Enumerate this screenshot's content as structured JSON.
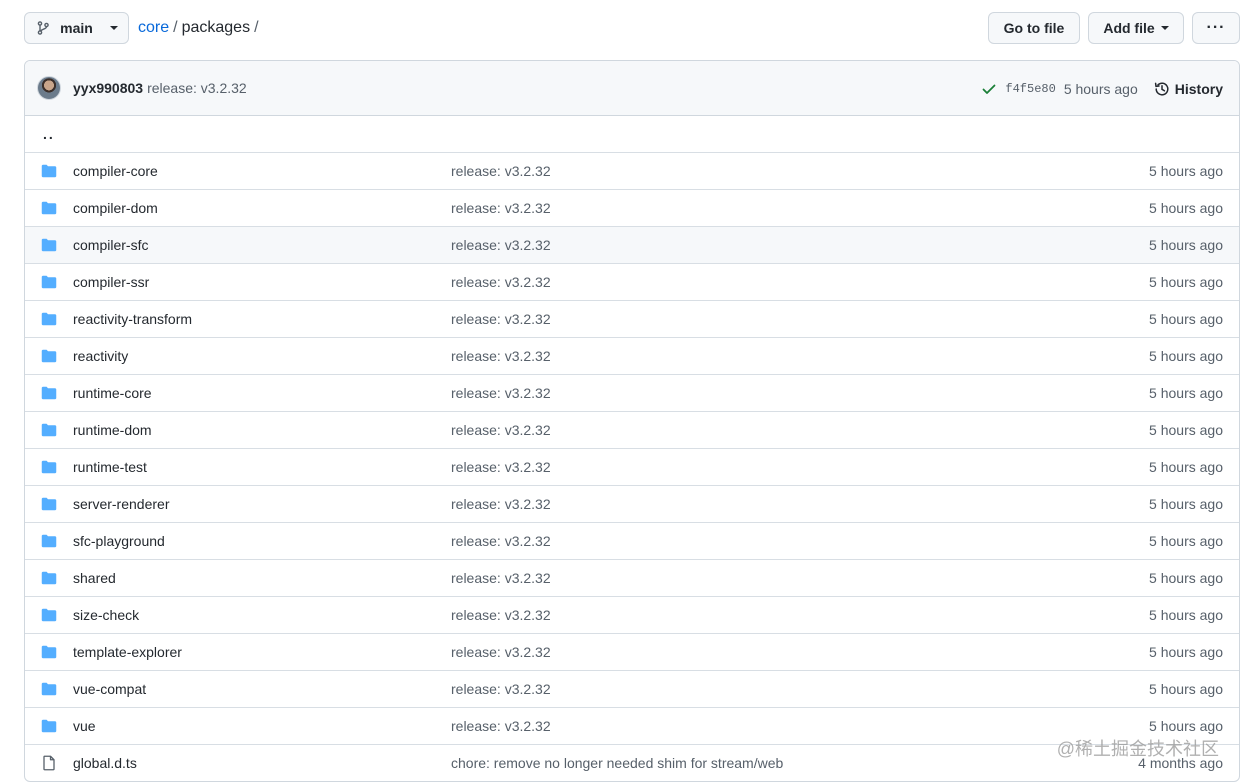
{
  "branch": {
    "label": "main"
  },
  "breadcrumb": {
    "repo": "core",
    "sep1": "/",
    "dir": "packages",
    "sep2": "/"
  },
  "actions": {
    "goto_file": "Go to file",
    "add_file": "Add file",
    "more": "···"
  },
  "commit": {
    "author": "yyx990803",
    "message": "release: v3.2.32",
    "sha": "f4f5e80",
    "time": "5 hours ago",
    "history_label": "History"
  },
  "parent_link": "..",
  "files": [
    {
      "name": "compiler-core",
      "message": "release: v3.2.32",
      "time": "5 hours ago",
      "type": "dir"
    },
    {
      "name": "compiler-dom",
      "message": "release: v3.2.32",
      "time": "5 hours ago",
      "type": "dir"
    },
    {
      "name": "compiler-sfc",
      "message": "release: v3.2.32",
      "time": "5 hours ago",
      "type": "dir"
    },
    {
      "name": "compiler-ssr",
      "message": "release: v3.2.32",
      "time": "5 hours ago",
      "type": "dir"
    },
    {
      "name": "reactivity-transform",
      "message": "release: v3.2.32",
      "time": "5 hours ago",
      "type": "dir"
    },
    {
      "name": "reactivity",
      "message": "release: v3.2.32",
      "time": "5 hours ago",
      "type": "dir"
    },
    {
      "name": "runtime-core",
      "message": "release: v3.2.32",
      "time": "5 hours ago",
      "type": "dir"
    },
    {
      "name": "runtime-dom",
      "message": "release: v3.2.32",
      "time": "5 hours ago",
      "type": "dir"
    },
    {
      "name": "runtime-test",
      "message": "release: v3.2.32",
      "time": "5 hours ago",
      "type": "dir"
    },
    {
      "name": "server-renderer",
      "message": "release: v3.2.32",
      "time": "5 hours ago",
      "type": "dir"
    },
    {
      "name": "sfc-playground",
      "message": "release: v3.2.32",
      "time": "5 hours ago",
      "type": "dir"
    },
    {
      "name": "shared",
      "message": "release: v3.2.32",
      "time": "5 hours ago",
      "type": "dir"
    },
    {
      "name": "size-check",
      "message": "release: v3.2.32",
      "time": "5 hours ago",
      "type": "dir"
    },
    {
      "name": "template-explorer",
      "message": "release: v3.2.32",
      "time": "5 hours ago",
      "type": "dir"
    },
    {
      "name": "vue-compat",
      "message": "release: v3.2.32",
      "time": "5 hours ago",
      "type": "dir"
    },
    {
      "name": "vue",
      "message": "release: v3.2.32",
      "time": "5 hours ago",
      "type": "dir"
    },
    {
      "name": "global.d.ts",
      "message": "chore: remove no longer needed shim for stream/web",
      "time": "4 months ago",
      "type": "file"
    }
  ],
  "icons": {
    "directory": "folder-icon",
    "file": "file-icon",
    "branch": "git-branch-icon",
    "check": "check-icon",
    "history": "history-icon"
  },
  "colors": {
    "folder": "#54aeff",
    "link": "#0969da",
    "success": "#1a7f37"
  },
  "watermark": "@稀土掘金技术社区"
}
